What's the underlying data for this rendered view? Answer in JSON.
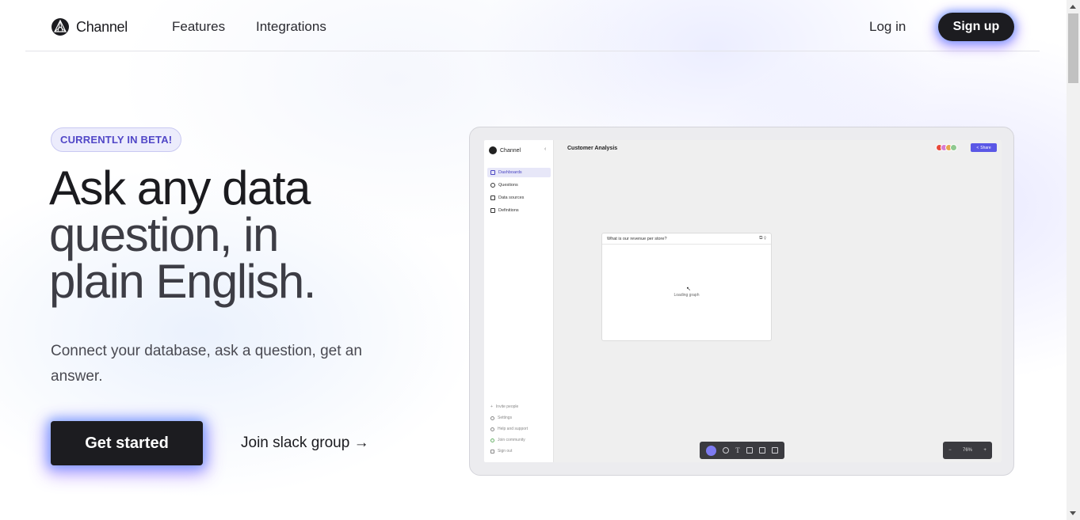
{
  "nav": {
    "brand": "Channel",
    "links": [
      "Features",
      "Integrations"
    ],
    "login": "Log in",
    "signup": "Sign up"
  },
  "hero": {
    "badge": "CURRENTLY IN BETA!",
    "title_line1": "Ask any data",
    "title_line2": "question, in",
    "title_line3": "plain English.",
    "subtitle": "Connect your database, ask a question, get an answer.",
    "cta_primary": "Get started",
    "cta_secondary": "Join slack group →"
  },
  "preview": {
    "app_brand": "Channel",
    "sidebar": [
      "Dashboards",
      "Questions",
      "Data sources",
      "Definitions"
    ],
    "sidebar_bottom": [
      "Invite people",
      "Settings",
      "Help and support",
      "Join community",
      "Sign out"
    ],
    "page_title": "Customer Analysis",
    "share": "Share",
    "card_title": "What is our revenue per store?",
    "card_status": "Loading graph",
    "zoom": "76%",
    "avatar_colors": [
      "#e84a3a",
      "#d77bd0",
      "#e7a64b",
      "#8fc98f"
    ]
  },
  "colors": {
    "accent": "#5147c7",
    "button_dark": "#1c1c20"
  }
}
